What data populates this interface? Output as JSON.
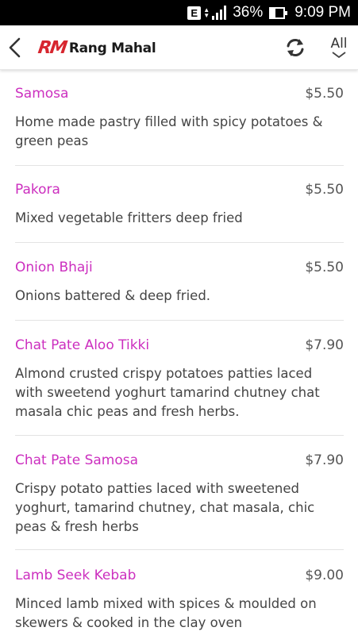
{
  "status_bar": {
    "network_badge": "E",
    "battery_percent": "36%",
    "time": "9:09 PM"
  },
  "header": {
    "logo_mark": "RM",
    "logo_text": "Rang Mahal",
    "filter_label": "All",
    "icons": [
      "back-arrow-icon",
      "refresh-icon",
      "chevron-down-icon"
    ]
  },
  "menu": {
    "items": [
      {
        "name": "Samosa",
        "price": "$5.50",
        "description": "Home made pastry filled with spicy potatoes & green peas"
      },
      {
        "name": "Pakora",
        "price": "$5.50",
        "description": "Mixed vegetable fritters deep fried"
      },
      {
        "name": "Onion Bhaji",
        "price": "$5.50",
        "description": "Onions battered & deep fried."
      },
      {
        "name": "Chat Pate Aloo Tikki",
        "price": "$7.90",
        "description": "Almond crusted crispy potatoes patties laced with sweetend yoghurt tamarind chutney chat masala chic peas and fresh herbs."
      },
      {
        "name": "Chat Pate Samosa",
        "price": "$7.90",
        "description": "Crispy potato patties laced with sweetened yoghurt, tamarind chutney, chat masala, chic peas & fresh herbs"
      },
      {
        "name": "Lamb Seek Kebab",
        "price": "$9.00",
        "description": "Minced lamb mixed with spices & moulded on skewers & cooked in the clay oven"
      }
    ]
  },
  "colors": {
    "item_name": "#cc2fbf",
    "logo_red": "#d7262f",
    "status_bar": "#000000"
  }
}
